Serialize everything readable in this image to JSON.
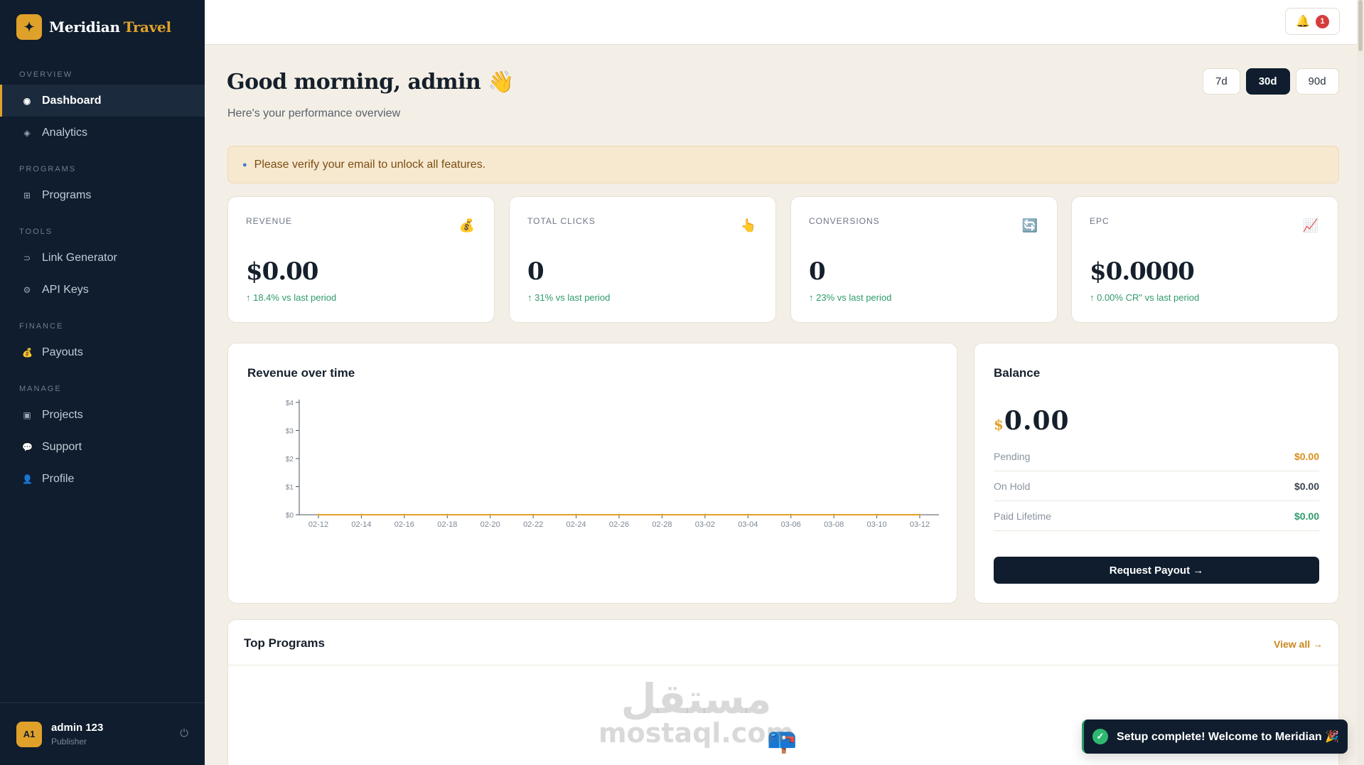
{
  "brand": {
    "mark": "✦",
    "name": "Meridian",
    "accent": "Travel"
  },
  "sidebar": {
    "sections": [
      {
        "title": "OVERVIEW",
        "items": [
          {
            "label": "Dashboard",
            "icon": "dot-icon",
            "glyph": "◉",
            "active": true
          },
          {
            "label": "Analytics",
            "icon": "diamond-icon",
            "glyph": "◈"
          }
        ]
      },
      {
        "title": "PROGRAMS",
        "items": [
          {
            "label": "Programs",
            "icon": "grid-icon",
            "glyph": "⊞"
          }
        ]
      },
      {
        "title": "TOOLS",
        "items": [
          {
            "label": "Link Generator",
            "icon": "link-icon",
            "glyph": "⊃"
          },
          {
            "label": "API Keys",
            "icon": "key-icon",
            "glyph": "⚙"
          }
        ]
      },
      {
        "title": "FINANCE",
        "items": [
          {
            "label": "Payouts",
            "icon": "money-bag-icon",
            "glyph": "💰"
          }
        ]
      },
      {
        "title": "MANAGE",
        "items": [
          {
            "label": "Projects",
            "icon": "folder-icon",
            "glyph": "▣"
          },
          {
            "label": "Support",
            "icon": "chat-bubble-icon",
            "glyph": "💬"
          },
          {
            "label": "Profile",
            "icon": "person-icon",
            "glyph": "👤"
          }
        ]
      }
    ]
  },
  "user": {
    "initials": "A1",
    "name": "admin 123",
    "role": "Publisher"
  },
  "topbar": {
    "notification_count": "1"
  },
  "header": {
    "greeting": "Good morning, admin 👋",
    "subtitle": "Here's your performance overview",
    "ranges": [
      "7d",
      "30d",
      "90d"
    ],
    "active_range": "30d"
  },
  "alert": {
    "text": "Please verify your email to unlock all features."
  },
  "stats": [
    {
      "label": "REVENUE",
      "value": "$0.00",
      "delta": "↑ 18.4% vs last period",
      "icon": "money-bag-icon",
      "glyph": "💰"
    },
    {
      "label": "TOTAL CLICKS",
      "value": "0",
      "delta": "↑ 31% vs last period",
      "icon": "pointing-hand-icon",
      "glyph": "👆"
    },
    {
      "label": "CONVERSIONS",
      "value": "0",
      "delta": "↑ 23% vs last period",
      "icon": "refresh-icon",
      "glyph": "🔄"
    },
    {
      "label": "EPC",
      "value": "$0.0000",
      "delta": "↑ 0.00% CR\" vs last period",
      "icon": "chart-up-icon",
      "glyph": "📈"
    }
  ],
  "revenue_chart": {
    "title": "Revenue over time",
    "colors": {
      "line": "#e0a12a",
      "axis": "#4a5563",
      "tick": "#7c8794"
    }
  },
  "chart_data": {
    "type": "line",
    "title": "Revenue over time",
    "x": [
      "02-12",
      "02-14",
      "02-16",
      "02-18",
      "02-20",
      "02-22",
      "02-24",
      "02-26",
      "02-28",
      "03-02",
      "03-04",
      "03-06",
      "03-08",
      "03-10",
      "03-12"
    ],
    "y_ticks": [
      "$0",
      "$1",
      "$2",
      "$3",
      "$4"
    ],
    "series": [
      {
        "values": [
          0,
          0,
          0,
          0,
          0,
          0,
          0,
          0,
          0,
          0,
          0,
          0,
          0,
          0,
          0
        ]
      }
    ],
    "ylim": [
      0,
      4
    ],
    "xlabel": "",
    "ylabel": "",
    "grid": false
  },
  "balance": {
    "title": "Balance",
    "currency": "$",
    "amount": "0.00",
    "rows": [
      {
        "label": "Pending",
        "value": "$0.00",
        "color": "#d98e1c"
      },
      {
        "label": "On Hold",
        "value": "$0.00",
        "color": "#3a4450"
      },
      {
        "label": "Paid Lifetime",
        "value": "$0.00",
        "color": "#2e9a6a"
      }
    ],
    "button": "Request Payout →"
  },
  "programs": {
    "title": "Top Programs",
    "view_all": "View all →",
    "empty_icon": "📪"
  },
  "watermark": {
    "arabic": "مستقل",
    "latin": "mostaql.com"
  },
  "toast": {
    "text": "Setup complete! Welcome to Meridian 🎉"
  }
}
